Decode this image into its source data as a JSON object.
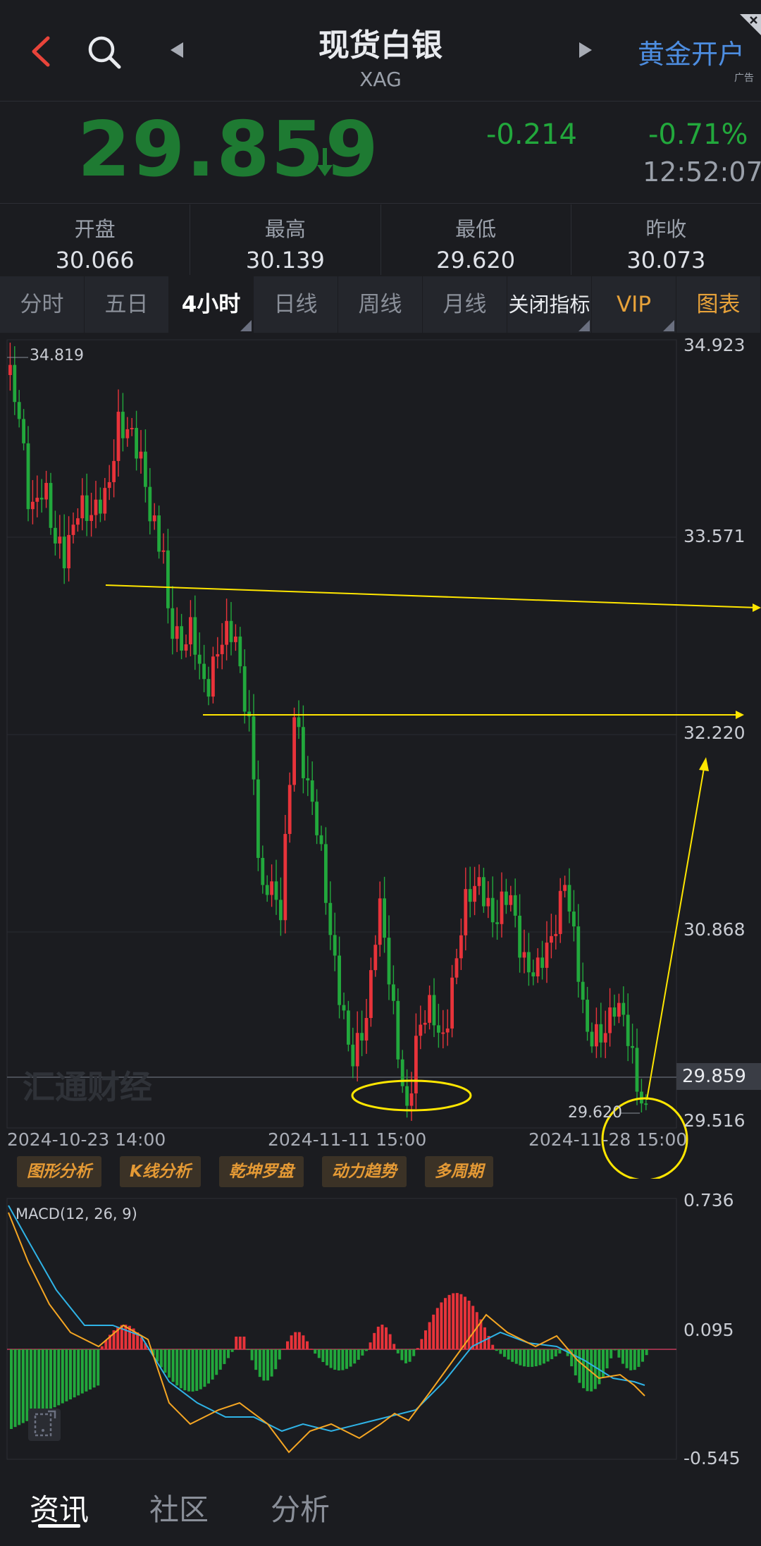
{
  "header": {
    "title": "现货白银",
    "subtitle": "XAG",
    "ad_label": "黄金开户",
    "ad_tag": "广告"
  },
  "quote": {
    "price": "29.859",
    "change": "-0.214",
    "change_pct": "-0.71%",
    "time": "12:52:07"
  },
  "stats": [
    {
      "label": "开盘",
      "value": "30.066"
    },
    {
      "label": "最高",
      "value": "30.139"
    },
    {
      "label": "最低",
      "value": "29.620"
    },
    {
      "label": "昨收",
      "value": "30.073"
    }
  ],
  "tabs": [
    {
      "label": "分时"
    },
    {
      "label": "五日"
    },
    {
      "label": "4小时"
    },
    {
      "label": "日线"
    },
    {
      "label": "周线"
    },
    {
      "label": "月线"
    },
    {
      "label": "关闭指标"
    },
    {
      "label": "VIP"
    },
    {
      "label": "图表"
    }
  ],
  "main_chart": {
    "y_ticks": [
      "34.923",
      "33.571",
      "32.220",
      "30.868",
      "29.516"
    ],
    "current_price_tag": "29.859",
    "high_label": "34.819",
    "low_label": "29.620",
    "x_ticks": [
      "2024-10-23 14:00",
      "2024-11-11 15:00",
      "2024-11-28 15:00"
    ],
    "watermark": "汇通财经"
  },
  "tools": [
    "图形分析",
    "K线分析",
    "乾坤罗盘",
    "动力趋势",
    "多周期"
  ],
  "macd": {
    "title": "MACD(12, 26, 9)",
    "y_ticks": [
      "0.736",
      "0.095",
      "-0.545"
    ]
  },
  "bottom_nav": [
    {
      "label": "资讯"
    },
    {
      "label": "社区"
    },
    {
      "label": "分析"
    }
  ],
  "colors": {
    "up": "#e8333a",
    "down": "#22a83c",
    "annotation": "#ffe600",
    "dif_line": "#f5a623",
    "dea_line": "#2fb3e6"
  }
}
